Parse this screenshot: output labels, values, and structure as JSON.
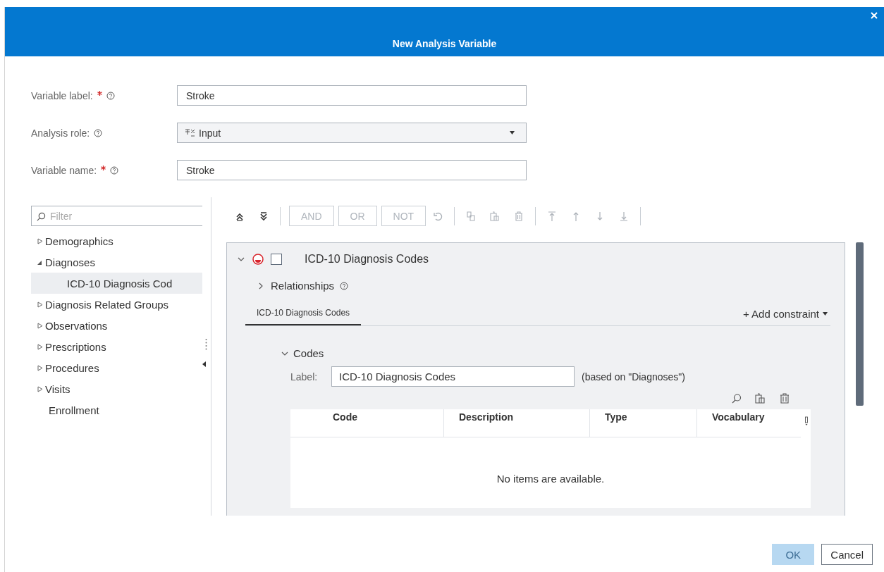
{
  "dialog": {
    "title": "New Analysis Variable"
  },
  "form": [
    {
      "label": "Variable label:",
      "required": true,
      "kind": "text",
      "value": "Stroke"
    },
    {
      "label": "Analysis role:",
      "required": false,
      "kind": "dropdown",
      "value": "Input"
    },
    {
      "label": "Variable name:",
      "required": true,
      "kind": "text",
      "value": "Stroke"
    }
  ],
  "filter": {
    "placeholder": "Filter"
  },
  "tree": [
    {
      "label": "Demographics",
      "kind": "group",
      "expanded": false,
      "selected": false
    },
    {
      "label": "Diagnoses",
      "kind": "group",
      "expanded": true,
      "selected": false,
      "children": [
        {
          "label": "ICD-10 Diagnosis Cod",
          "kind": "leaf",
          "selected": true
        }
      ]
    },
    {
      "label": "Diagnosis Related Groups",
      "kind": "group",
      "expanded": false,
      "selected": false
    },
    {
      "label": "Observations",
      "kind": "group",
      "expanded": false,
      "selected": false
    },
    {
      "label": "Prescriptions",
      "kind": "group",
      "expanded": false,
      "selected": false
    },
    {
      "label": "Procedures",
      "kind": "group",
      "expanded": false,
      "selected": false
    },
    {
      "label": "Visits",
      "kind": "group",
      "expanded": false,
      "selected": false
    },
    {
      "label": "Enrollment",
      "kind": "leaf",
      "selected": false
    }
  ],
  "toolbar": [
    {
      "kind": "collapse-all",
      "disabled": false
    },
    {
      "kind": "expand-all",
      "disabled": false
    },
    {
      "kind": "separator"
    },
    {
      "kind": "text",
      "label": "AND",
      "disabled": true
    },
    {
      "kind": "text",
      "label": "OR",
      "disabled": true
    },
    {
      "kind": "text",
      "label": "NOT",
      "disabled": true
    },
    {
      "kind": "undo",
      "disabled": true
    },
    {
      "kind": "separator"
    },
    {
      "kind": "copy",
      "disabled": true
    },
    {
      "kind": "paste",
      "disabled": true
    },
    {
      "kind": "delete",
      "disabled": true
    },
    {
      "kind": "separator"
    },
    {
      "kind": "top",
      "disabled": true
    },
    {
      "kind": "up",
      "disabled": true
    },
    {
      "kind": "down",
      "disabled": true
    },
    {
      "kind": "bottom",
      "disabled": true
    },
    {
      "kind": "separator"
    }
  ],
  "card": {
    "title": "ICD-10 Diagnosis Codes",
    "expanded": true,
    "checked": false,
    "relationships": {
      "label": "Relationships",
      "expanded": false
    },
    "tabs": [
      {
        "label": "ICD-10 Diagnosis Codes",
        "selected": true
      }
    ],
    "add_constraint": "+ Add constraint",
    "codes": {
      "title": "Codes",
      "expanded": true,
      "label_caption": "Label:",
      "label_value": "ICD-10 Diagnosis Codes",
      "note": "(based on \"Diagnoses\")",
      "table": {
        "columns": [
          "Code",
          "Description",
          "Type",
          "Vocabulary"
        ],
        "empty_message": "No items are available."
      }
    }
  },
  "buttons": [
    {
      "label": "OK",
      "kind": "primary",
      "disabled": true
    },
    {
      "label": "Cancel",
      "kind": "secondary",
      "disabled": false
    }
  ]
}
